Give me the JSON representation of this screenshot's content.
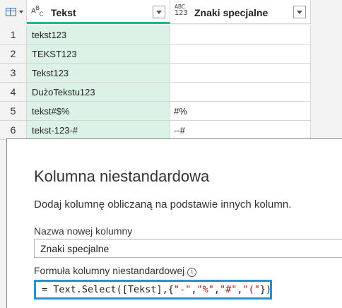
{
  "grid": {
    "columns": [
      {
        "type_icon": "text-type-icon",
        "type_top": "A",
        "type_b": "B",
        "type_c": "C",
        "title": "Tekst"
      },
      {
        "type_icon": "any-type-icon",
        "type_top": "ABC",
        "type_bottom": "123",
        "title": "Znaki specjalne"
      }
    ],
    "rows": [
      {
        "n": "1",
        "tekst": "tekst123",
        "znaki": ""
      },
      {
        "n": "2",
        "tekst": "TEKST123",
        "znaki": ""
      },
      {
        "n": "3",
        "tekst": "Tekst123",
        "znaki": ""
      },
      {
        "n": "4",
        "tekst": "DużoTekstu123",
        "znaki": ""
      },
      {
        "n": "5",
        "tekst": "tekst#$%",
        "znaki": "#%"
      },
      {
        "n": "6",
        "tekst": "tekst-123-#",
        "znaki": "--#"
      }
    ],
    "colors": {
      "selected_column_bg": "#dcf2e7",
      "selected_column_border": "#1fb889"
    }
  },
  "dialog": {
    "title": "Kolumna niestandardowa",
    "description": "Dodaj kolumnę obliczaną na podstawie innych kolumn.",
    "name_label": "Nazwa nowej kolumny",
    "name_value": "Znaki specjalne",
    "formula_label": "Formuła kolumny niestandardowej",
    "info_glyph": "i",
    "formula": {
      "prefix": "= Text.Select([Tekst],{",
      "tokens": [
        "\"-\"",
        "\"%\"",
        "\"#\"",
        "\"(\""
      ],
      "separator": ",",
      "suffix": "})"
    },
    "colors": {
      "formula_border": "#2b8fd0",
      "string_literal": "#a31515"
    }
  }
}
